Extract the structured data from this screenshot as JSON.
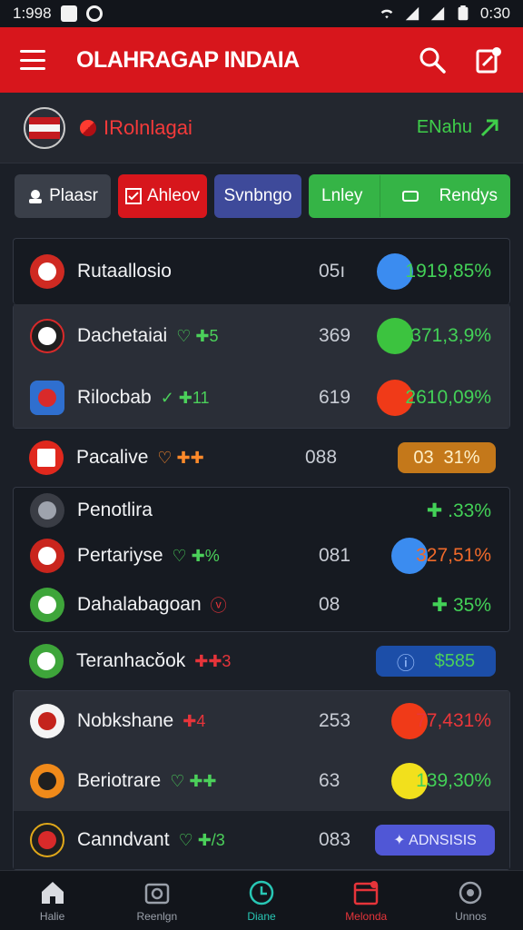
{
  "status_bar": {
    "time_left": "1:998",
    "time_right": "0:30"
  },
  "header": {
    "title": "OLAHRAGAP INDAIA"
  },
  "sub_header": {
    "league_name": "IRolnlagai",
    "action_label": "ENahu"
  },
  "filters": [
    {
      "label": "Plaasr"
    },
    {
      "label": "Ahleov"
    },
    {
      "label": "Svnbngo"
    },
    {
      "label": "Lnley"
    },
    {
      "label": "Rendys"
    }
  ],
  "rows": [
    {
      "name": "Rutaallosio",
      "score": "05ı",
      "pct": "1919,85%",
      "dot": "#3b8cf0",
      "pct_color": "#43d157"
    },
    {
      "name": "Dachetaiai",
      "tag": "♡ ✚5",
      "score": "369",
      "pct": "371,3,9%",
      "dot": "#3cc33f",
      "pct_color": "#43d157"
    },
    {
      "name": "Rilocbab",
      "tag": "✓ ✚11",
      "score": "619",
      "pct": "2610,09%",
      "dot": "#f03a18",
      "pct_color": "#43d157"
    },
    {
      "name": "Pacalive",
      "tag": "♡ ✚✚",
      "score": "088",
      "pill_left": "03",
      "pill_right": "31%"
    },
    {
      "name": "Penotlira",
      "pct": "✚ .33%"
    },
    {
      "name": "Pertariyse",
      "tag": "♡ ✚%",
      "score": "081",
      "pct": "327,51%",
      "dot": "#3b8cf0",
      "pct_color": "#f06a2a"
    },
    {
      "name": "Dahalabagoan",
      "tag": "ⓥ",
      "score": "08",
      "pct": "✚ 35%"
    },
    {
      "name": "Teranhacŏok",
      "tag": "✚✚3",
      "pill_right": "$585"
    },
    {
      "name": "Nobkshane",
      "tag": "✚4",
      "score": "253",
      "pct": "77,431%",
      "dot": "#f03a18",
      "pct_color": "#e9363a"
    },
    {
      "name": "Beriotrare",
      "tag": "♡ ✚✚",
      "score": "63",
      "pct": "139,30%",
      "dot": "#f2e01c",
      "pct_color": "#43d157"
    },
    {
      "name": "Canndvant",
      "tag": "♡ ✚/3",
      "score": "083",
      "pill_right": "✦ ADNSISIS"
    }
  ],
  "nav": [
    {
      "label": "Halie"
    },
    {
      "label": "Reenlgn"
    },
    {
      "label": "Diane"
    },
    {
      "label": "Melonda"
    },
    {
      "label": "Unnos"
    }
  ]
}
